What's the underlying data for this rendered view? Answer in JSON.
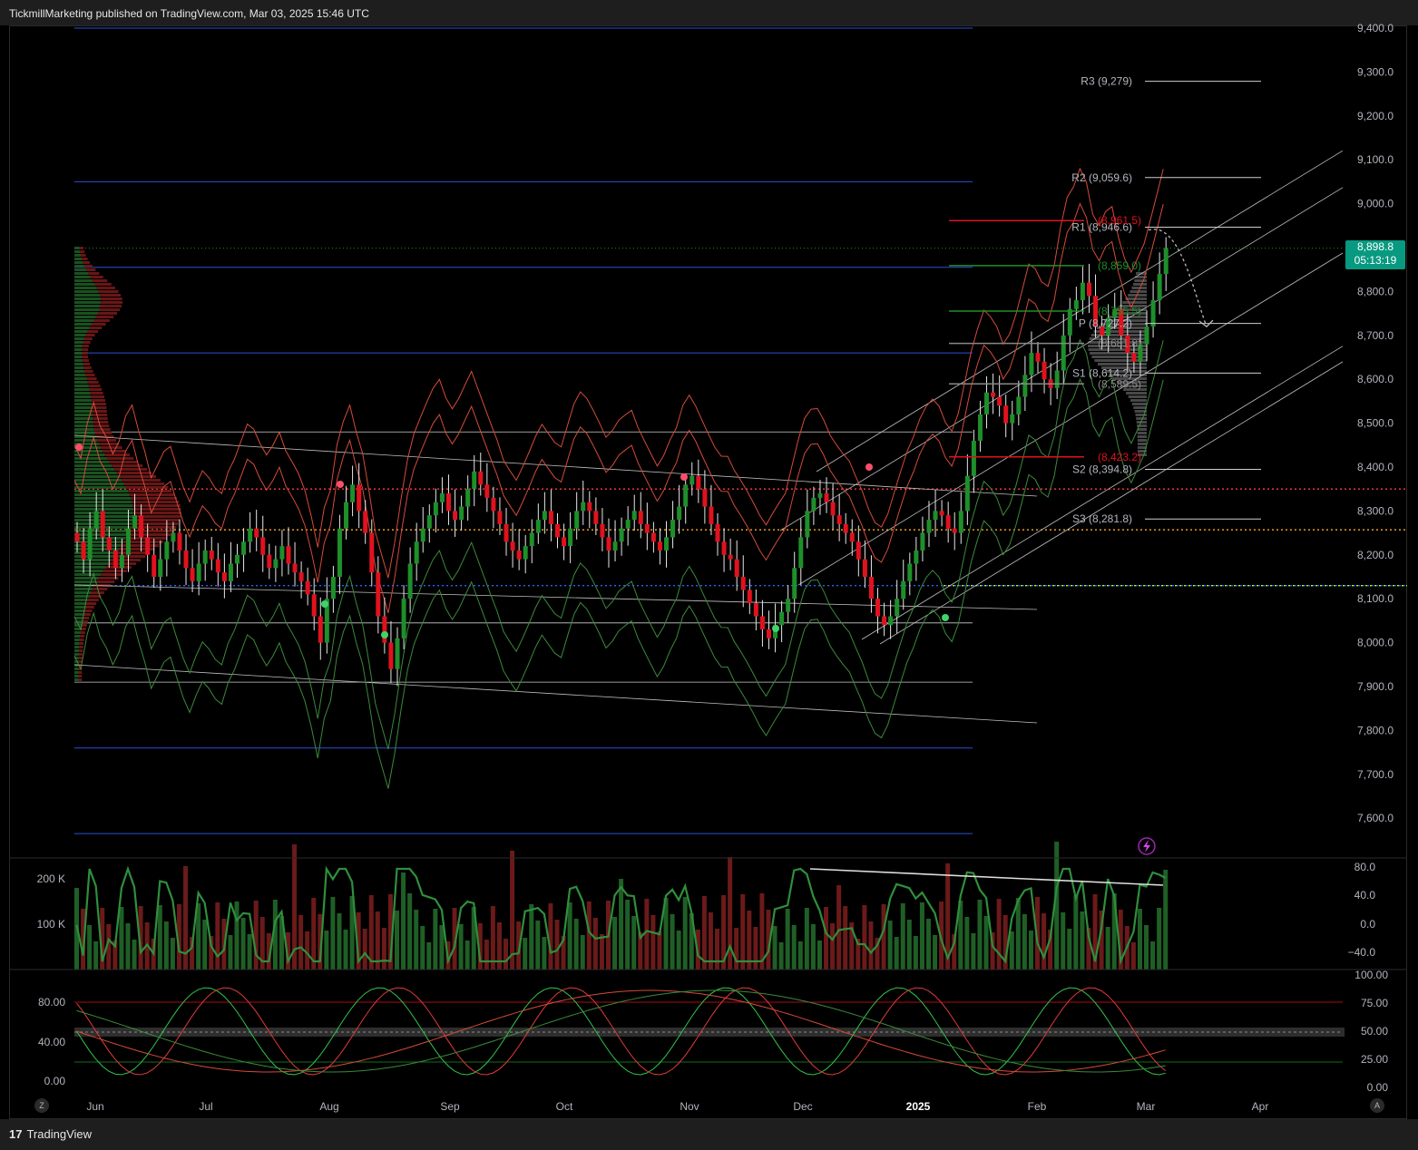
{
  "header": {
    "publisher": "TickmillMarketing",
    "published_on": "published on TradingView.com, Mar 03, 2025 15:46 UTC"
  },
  "footer": {
    "brand": "TradingView",
    "brand_mark": "17"
  },
  "axis_buttons": {
    "left": "Z",
    "right": "A"
  },
  "colors": {
    "up": "#1e8f2a",
    "down": "#e0121e",
    "channel": "#bfbfbf",
    "blue_level": "#2d4fd6",
    "bollinger": "#d44b3a",
    "keltner": "#3b8a3b",
    "rsi_line": "#2f8f3b",
    "stoch_k": "#31c44a",
    "stoch_d": "#e03a3a"
  },
  "main": {
    "price_axis_labels": [
      "9,400.0",
      "9,300.0",
      "9,200.0",
      "9,100.0",
      "9,000.0",
      "8,900.0",
      "8,800.0",
      "8,700.0",
      "8,600.0",
      "8,500.0",
      "8,400.0",
      "8,300.0",
      "8,200.0",
      "8,100.0",
      "8,000.0",
      "7,900.0",
      "7,800.0",
      "7,700.0",
      "7,600.0"
    ],
    "last_price": "8,898.8",
    "countdown": "05:13:19",
    "pivots": [
      {
        "label": "R3 (9,279)",
        "price": 9279
      },
      {
        "label": "R2 (9,059.6)",
        "price": 9059.6
      },
      {
        "label": "R1 (8,946.6)",
        "price": 8946.6
      },
      {
        "label": "P (8,727.2)",
        "price": 8727.2
      },
      {
        "label": "S1 (8,614.2)",
        "price": 8614.2
      },
      {
        "label": "S2 (8,394.8)",
        "price": 8394.8
      },
      {
        "label": "S3 (8,281.8)",
        "price": 8281.8
      }
    ],
    "fib_levels": [
      {
        "label": "(8,961.5)",
        "price": 8961.5,
        "color": "#e0121e"
      },
      {
        "label": "(8,859.0)",
        "price": 8859.0,
        "color": "#1e8f2a"
      },
      {
        "label": "(8,755.5)",
        "price": 8755.5,
        "color": "#1e8f2a"
      },
      {
        "label": "(8,681.8)",
        "price": 8681.8,
        "color": "#888888"
      },
      {
        "label": "(8,589.5)",
        "price": 8589.5,
        "color": "#888888"
      },
      {
        "label": "(8,423.2)",
        "price": 8423.2,
        "color": "#e0121e"
      }
    ]
  },
  "time_axis": [
    "Jun",
    "Jul",
    "Aug",
    "Sep",
    "Oct",
    "Nov",
    "Dec",
    "2025",
    "Feb",
    "Mar",
    "Apr"
  ],
  "volume_pane": {
    "left_labels": [
      "200 K",
      "100 K"
    ],
    "right_labels": [
      "80.0",
      "40.0",
      "0.0",
      "−40.0"
    ]
  },
  "oscillator_pane": {
    "left_labels": [
      "80.00",
      "40.00",
      "0.00"
    ],
    "right_labels": [
      "100.00",
      "75.00",
      "50.00",
      "25.00",
      "0.00"
    ]
  },
  "chart_data": {
    "type": "candlestick",
    "title": "",
    "x_range": [
      "2025-05-25",
      "2025-04-30"
    ],
    "ylim": [
      7550,
      9420
    ],
    "close_series": [
      8230,
      8190,
      8260,
      8300,
      8240,
      8210,
      8170,
      8200,
      8260,
      8290,
      8240,
      8200,
      8150,
      8190,
      8230,
      8250,
      8210,
      8170,
      8140,
      8180,
      8210,
      8190,
      8160,
      8140,
      8180,
      8200,
      8230,
      8260,
      8240,
      8200,
      8170,
      8190,
      8220,
      8180,
      8160,
      8140,
      8110,
      8060,
      8000,
      8100,
      8150,
      8260,
      8320,
      8360,
      8300,
      8250,
      8160,
      8060,
      8000,
      7940,
      8010,
      8100,
      8180,
      8230,
      8260,
      8290,
      8320,
      8340,
      8300,
      8280,
      8310,
      8350,
      8390,
      8360,
      8330,
      8300,
      8270,
      8230,
      8210,
      8190,
      8220,
      8250,
      8280,
      8300,
      8270,
      8240,
      8220,
      8260,
      8300,
      8320,
      8300,
      8270,
      8240,
      8210,
      8230,
      8260,
      8280,
      8300,
      8270,
      8250,
      8230,
      8210,
      8240,
      8280,
      8310,
      8360,
      8380,
      8350,
      8310,
      8270,
      8230,
      8200,
      8190,
      8150,
      8120,
      8090,
      8060,
      8030,
      8010,
      8040,
      8070,
      8100,
      8170,
      8240,
      8300,
      8330,
      8340,
      8320,
      8290,
      8270,
      8250,
      8230,
      8190,
      8150,
      8100,
      8060,
      8040,
      8060,
      8100,
      8140,
      8180,
      8210,
      8250,
      8280,
      8300,
      8290,
      8260,
      8250,
      8300,
      8380,
      8460,
      8520,
      8570,
      8560,
      8540,
      8500,
      8520,
      8560,
      8610,
      8660,
      8640,
      8600,
      8580,
      8620,
      8700,
      8760,
      8780,
      8820,
      8790,
      8720,
      8700,
      8740,
      8760,
      8700,
      8660,
      8640,
      8680,
      8720,
      8780,
      8840,
      8898.8
    ],
    "annotation_path": {
      "from_price": 8940,
      "to_price": 8720
    }
  }
}
